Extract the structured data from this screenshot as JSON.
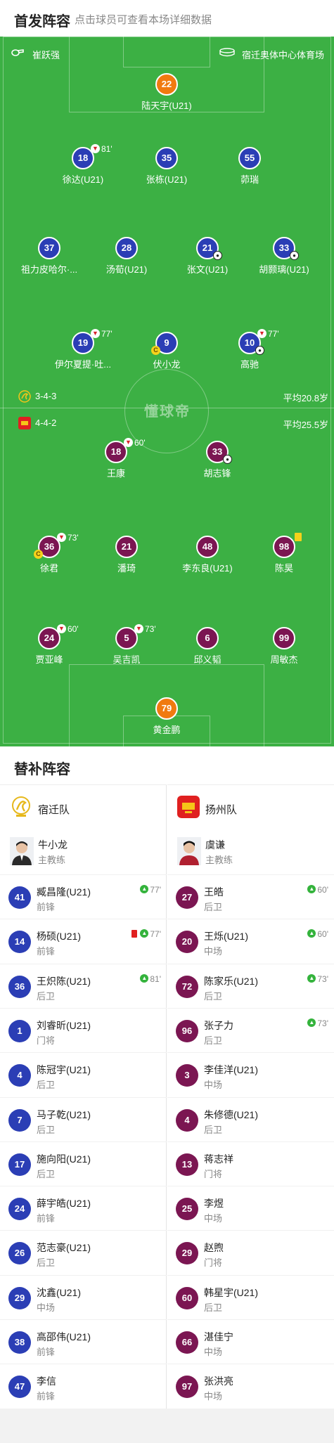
{
  "header": {
    "title": "首发阵容",
    "hint": "点击球员可查看本场详细数据"
  },
  "pitch": {
    "referee": "崔跃强",
    "stadium": "宿迁奥体中心体育场",
    "watermark": "懂球帝",
    "home_formation": "3-4-3",
    "home_avg_age": "平均20.8岁",
    "away_formation": "4-4-2",
    "away_avg_age": "平均25.5岁",
    "home_players": [
      {
        "number": "22",
        "name": "陆天宇(U21)"
      },
      {
        "number": "18",
        "name": "徐达(U21)",
        "sub_minute": "81'"
      },
      {
        "number": "35",
        "name": "张栋(U21)"
      },
      {
        "number": "55",
        "name": "茆瑞"
      },
      {
        "number": "37",
        "name": "祖力皮哈尔·..."
      },
      {
        "number": "28",
        "name": "汤荀(U21)"
      },
      {
        "number": "21",
        "name": "张文(U21)"
      },
      {
        "number": "33",
        "name": "胡颢璃(U21)"
      },
      {
        "number": "19",
        "name": "伊尔夏提·吐...",
        "sub_minute": "77'"
      },
      {
        "number": "9",
        "name": "伏小龙"
      },
      {
        "number": "10",
        "name": "高驰",
        "sub_minute": "77'"
      }
    ],
    "away_players": [
      {
        "number": "18",
        "name": "王康",
        "sub_minute": "60'"
      },
      {
        "number": "33",
        "name": "胡志锋"
      },
      {
        "number": "36",
        "name": "徐君",
        "sub_minute": "73'"
      },
      {
        "number": "21",
        "name": "潘琦"
      },
      {
        "number": "48",
        "name": "李东良(U21)"
      },
      {
        "number": "98",
        "name": "陈昊"
      },
      {
        "number": "24",
        "name": "贾亚峰",
        "sub_minute": "60'"
      },
      {
        "number": "5",
        "name": "吴吉凯",
        "sub_minute": "73'"
      },
      {
        "number": "6",
        "name": "邱义韬"
      },
      {
        "number": "99",
        "name": "周敏杰"
      },
      {
        "number": "79",
        "name": "黄金鹏"
      }
    ],
    "captain_mark": "C"
  },
  "subs": {
    "title": "替补阵容",
    "home": {
      "team": "宿迁队",
      "coach_name": "牛小龙",
      "coach_role": "主教练",
      "players": [
        {
          "number": "41",
          "name": "臧昌隆(U21)",
          "position": "前锋",
          "in": "77'"
        },
        {
          "number": "14",
          "name": "杨硕(U21)",
          "position": "前锋",
          "in": "77'"
        },
        {
          "number": "36",
          "name": "王炽陈(U21)",
          "position": "后卫",
          "in": "81'"
        },
        {
          "number": "1",
          "name": "刘睿昕(U21)",
          "position": "门将"
        },
        {
          "number": "4",
          "name": "陈冠宇(U21)",
          "position": "后卫"
        },
        {
          "number": "7",
          "name": "马子乾(U21)",
          "position": "后卫"
        },
        {
          "number": "17",
          "name": "施向阳(U21)",
          "position": "后卫"
        },
        {
          "number": "24",
          "name": "薛宇皓(U21)",
          "position": "前锋"
        },
        {
          "number": "26",
          "name": "范志豪(U21)",
          "position": "后卫"
        },
        {
          "number": "29",
          "name": "沈鑫(U21)",
          "position": "中场"
        },
        {
          "number": "38",
          "name": "高邵伟(U21)",
          "position": "前锋"
        },
        {
          "number": "47",
          "name": "李信",
          "position": "前锋"
        }
      ]
    },
    "away": {
      "team": "扬州队",
      "coach_name": "虞谦",
      "coach_role": "主教练",
      "players": [
        {
          "number": "27",
          "name": "王皓",
          "position": "后卫",
          "in": "60'"
        },
        {
          "number": "20",
          "name": "王烁(U21)",
          "position": "中场",
          "in": "60'"
        },
        {
          "number": "72",
          "name": "陈家乐(U21)",
          "position": "后卫",
          "in": "73'"
        },
        {
          "number": "96",
          "name": "张子力",
          "position": "后卫",
          "in": "73'"
        },
        {
          "number": "3",
          "name": "李佳洋(U21)",
          "position": "中场"
        },
        {
          "number": "4",
          "name": "朱修德(U21)",
          "position": "后卫"
        },
        {
          "number": "13",
          "name": "蒋志祥",
          "position": "门将"
        },
        {
          "number": "25",
          "name": "李煜",
          "position": "中场"
        },
        {
          "number": "29",
          "name": "赵煦",
          "position": "门将"
        },
        {
          "number": "60",
          "name": "韩星宇(U21)",
          "position": "后卫"
        },
        {
          "number": "66",
          "name": "湛佳宁",
          "position": "中场"
        },
        {
          "number": "97",
          "name": "张洪亮",
          "position": "中场"
        }
      ]
    }
  },
  "colors": {
    "pitch": "#3cb044",
    "home": "#2b3eb5",
    "away": "#7b1652",
    "goalkeeper": "#f07a10",
    "sub_in": "#34b33c",
    "sub_out": "#d8252b"
  },
  "icons": {
    "referee": "whistle-icon",
    "stadium": "stadium-icon",
    "goal": "football-icon",
    "yellow_card": "yellow-card-icon",
    "red_card": "red-card-icon"
  }
}
